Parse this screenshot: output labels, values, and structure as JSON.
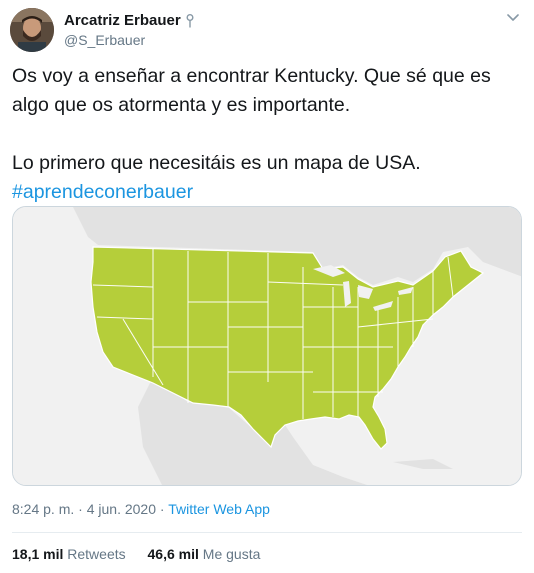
{
  "author": {
    "display_name": "Arcatriz Erbauer",
    "handle": "@S_Erbauer",
    "badge_icon": "pin-icon"
  },
  "tweet": {
    "line1": "Os voy a enseñar a encontrar Kentucky. Que sé que es algo que os atormenta y es importante.",
    "line2": "Lo primero que necesitáis es un mapa de USA.",
    "hashtag": "#aprendeconerbauer"
  },
  "media": {
    "description_icon": "usa-map-image",
    "land_color": "#b5ce3a",
    "background_color": "#f1f1f1",
    "outside_land_color": "#e0e0e0"
  },
  "meta": {
    "time": "8:24 p. m.",
    "separator1": " · ",
    "date": "4 jun. 2020",
    "separator2": " · ",
    "source": "Twitter Web App"
  },
  "stats": {
    "retweets_count": "18,1 mil",
    "retweets_label": "Retweets",
    "likes_count": "46,6 mil",
    "likes_label": "Me gusta"
  },
  "colors": {
    "link": "#1b95e0",
    "secondary_text": "#657786",
    "primary_text": "#14171a"
  }
}
